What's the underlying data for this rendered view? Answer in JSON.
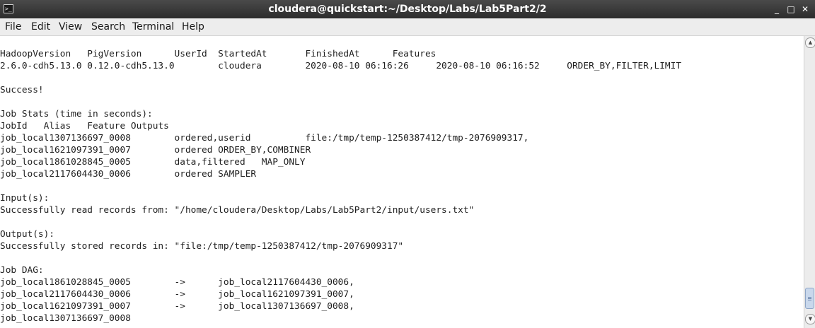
{
  "window": {
    "icon": "terminal-icon",
    "title": "cloudera@quickstart:~/Desktop/Labs/Lab5Part2/2",
    "controls": {
      "minimize": "_",
      "maximize": "□",
      "close": "✕"
    }
  },
  "menu": [
    "File",
    "Edit",
    "View",
    "Search",
    "Terminal",
    "Help"
  ],
  "terminal": {
    "lines": [
      "HadoopVersion   PigVersion      UserId  StartedAt       FinishedAt      Features",
      "2.6.0-cdh5.13.0 0.12.0-cdh5.13.0        cloudera        2020-08-10 06:16:26     2020-08-10 06:16:52     ORDER_BY,FILTER,LIMIT",
      "",
      "Success!",
      "",
      "Job Stats (time in seconds):",
      "JobId   Alias   Feature Outputs",
      "job_local1307136697_0008        ordered,userid          file:/tmp/temp-1250387412/tmp-2076909317,",
      "job_local1621097391_0007        ordered ORDER_BY,COMBINER",
      "job_local1861028845_0005        data,filtered   MAP_ONLY",
      "job_local2117604430_0006        ordered SAMPLER",
      "",
      "Input(s):",
      "Successfully read records from: \"/home/cloudera/Desktop/Labs/Lab5Part2/input/users.txt\"",
      "",
      "Output(s):",
      "Successfully stored records in: \"file:/tmp/temp-1250387412/tmp-2076909317\"",
      "",
      "Job DAG:",
      "job_local1861028845_0005        ->      job_local2117604430_0006,",
      "job_local2117604430_0006        ->      job_local1621097391_0007,",
      "job_local1621097391_0007        ->      job_local1307136697_0008,",
      "job_local1307136697_0008"
    ]
  },
  "scrollbar": {
    "up_arrow": "▲",
    "down_arrow": "▼",
    "scroll_position": 0.98
  },
  "colors": {
    "titlebar": "#333333",
    "menubar": "#ededed",
    "terminal_bg": "#ffffff",
    "terminal_fg": "#1e1e1e",
    "scroll_thumb": "#c9d8ec"
  }
}
